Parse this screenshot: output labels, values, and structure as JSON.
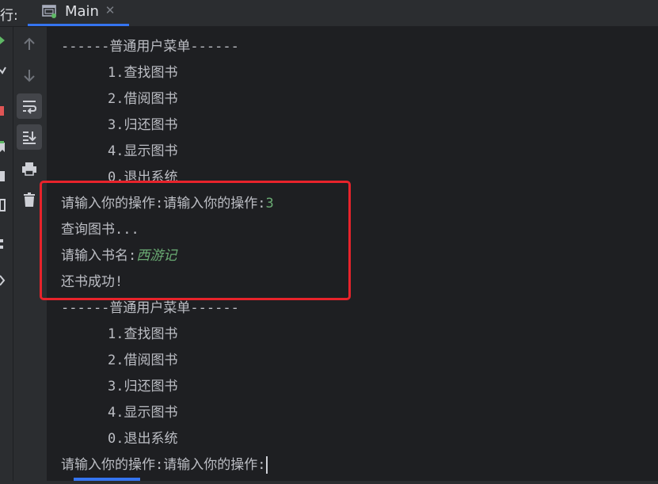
{
  "topbar": {
    "run_label": "行:",
    "tab": {
      "label": "Main",
      "close": "✕"
    }
  },
  "toolbar": {
    "buttons": [
      {
        "name": "up-arrow-icon"
      },
      {
        "name": "down-arrow-icon"
      },
      {
        "name": "soft-wrap-icon",
        "active": true
      },
      {
        "name": "scroll-to-end-icon",
        "active": true
      },
      {
        "name": "print-icon"
      },
      {
        "name": "trash-icon"
      }
    ]
  },
  "console": {
    "menu1": {
      "title": "------普通用户菜单------",
      "items": [
        "1.查找图书",
        "2.借阅图书",
        "3.归还图书",
        "4.显示图书",
        "0.退出系统"
      ]
    },
    "prompt1": "请输入你的操作:请输入你的操作:",
    "input1": "3",
    "query": "查询图书...",
    "book_prompt": "请输入书名:",
    "book_input": "西游记",
    "result": "还书成功!",
    "menu2": {
      "title": "------普通用户菜单------",
      "items": [
        "1.查找图书",
        "2.借阅图书",
        "3.归还图书",
        "4.显示图书",
        "0.退出系统"
      ]
    },
    "prompt2": "请输入你的操作:请输入你的操作:"
  },
  "colors": {
    "highlight": "#e8232b",
    "input_text": "#6aab73",
    "accent": "#3574f0"
  }
}
